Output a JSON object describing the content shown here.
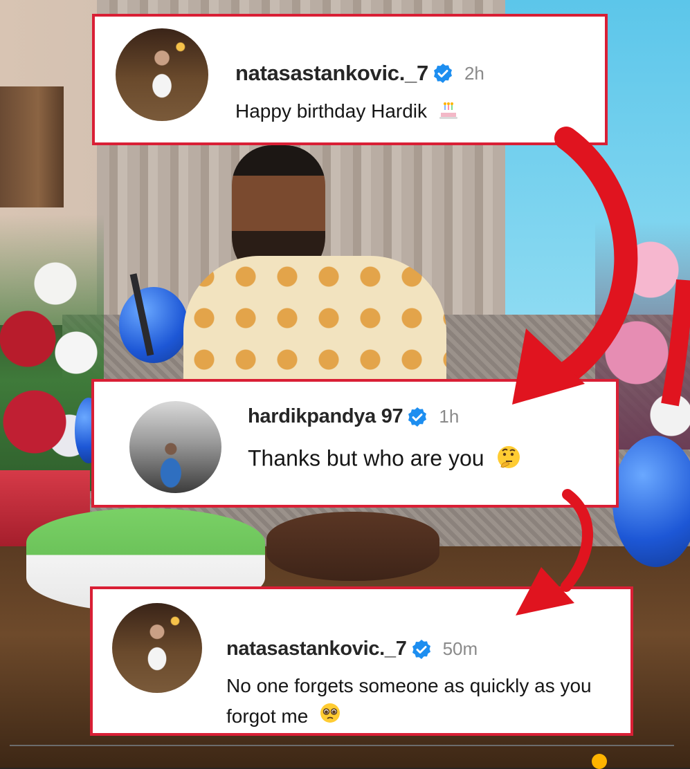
{
  "comments": [
    {
      "username": "natasastankovic._7",
      "time": "2h",
      "text": "Happy birthday Hardik",
      "emoji": "birthday-cake-emoji"
    },
    {
      "username": "hardikpandya 97",
      "time": "1h",
      "text": "Thanks but who are you",
      "emoji": "thinking-face-emoji"
    },
    {
      "username": "natasastankovic._7",
      "time": "50m",
      "text": "No one forgets someone as quickly as you forgot me",
      "emoji": "pleading-face-emoji"
    }
  ],
  "icons": {
    "verified": "verified-badge-icon",
    "arrow": "red-curved-arrow"
  },
  "colors": {
    "card_border": "#d91f35",
    "verified_blue": "#1d8ef0",
    "arrow_red": "#e0141f",
    "username": "#262626",
    "time": "#8a8a8a"
  }
}
